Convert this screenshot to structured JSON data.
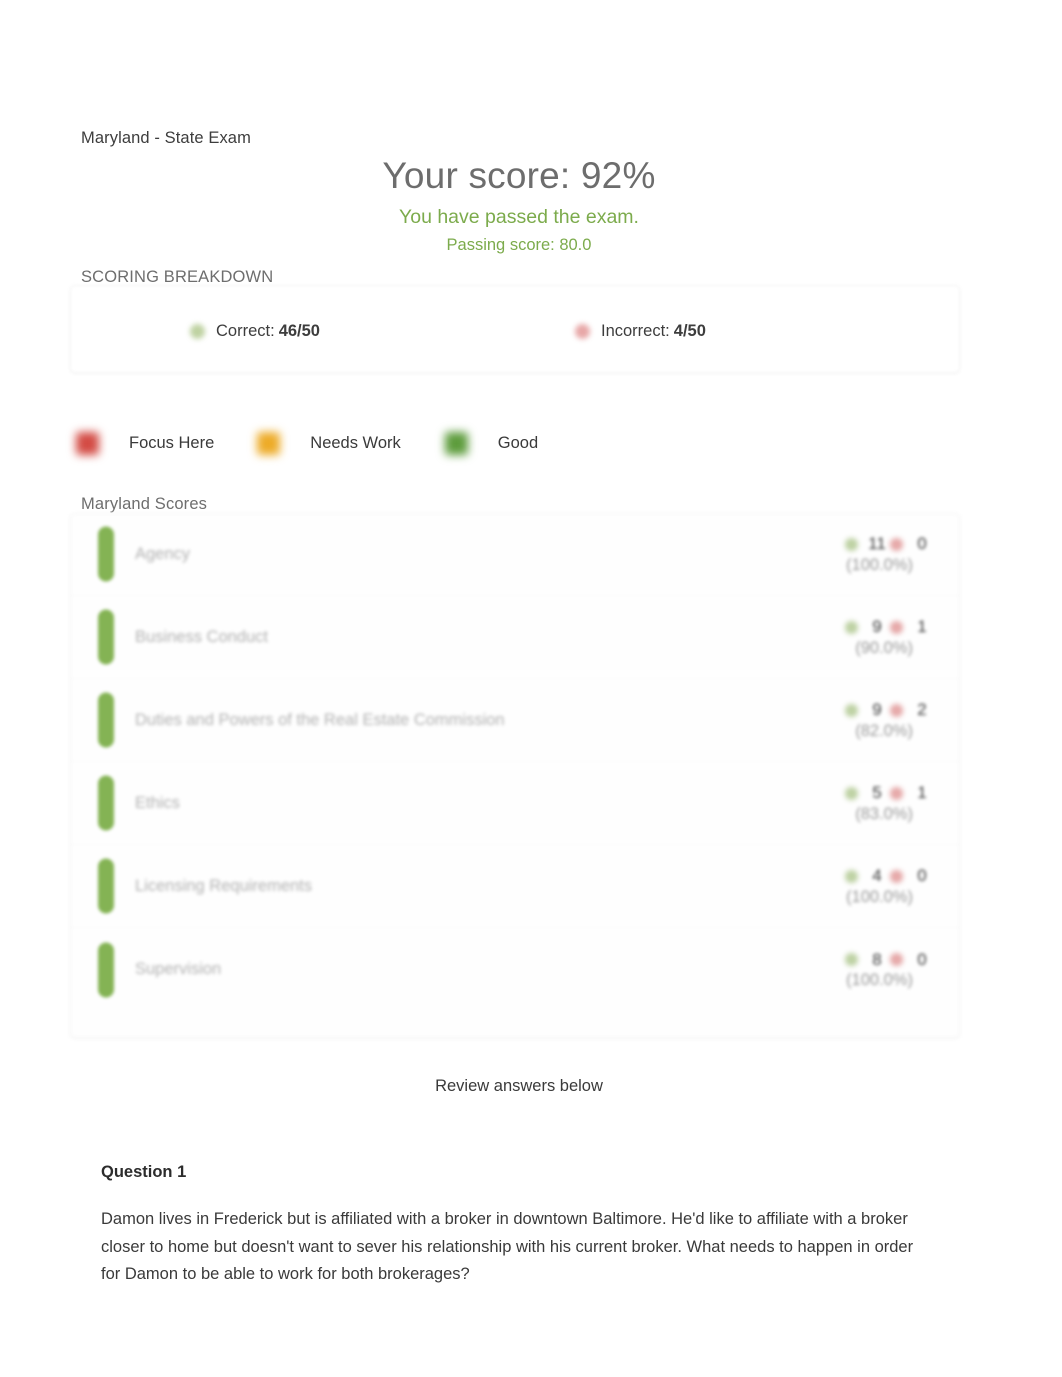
{
  "exam": {
    "title": "Maryland - State Exam"
  },
  "result": {
    "score_heading": "Your score: 92%",
    "pass_message": "You have passed the exam.",
    "passing_score_line": "Passing score: 80.0"
  },
  "breakdown": {
    "section_label": "SCORING BREAKDOWN",
    "correct_label": "Correct:",
    "correct_value": "46/50",
    "incorrect_label": "Incorrect:",
    "incorrect_value": "4/50"
  },
  "legend": {
    "items": [
      {
        "label": "Focus Here",
        "color": "#d34b44",
        "key": "focus"
      },
      {
        "label": "Needs Work",
        "color": "#edab27",
        "key": "needs"
      },
      {
        "label": "Good",
        "color": "#5d9c3c",
        "key": "good"
      }
    ]
  },
  "scores": {
    "section_label": "Maryland Scores",
    "rows": [
      {
        "topic": "Agency",
        "correct": "11",
        "incorrect": "0",
        "percent": "(100.0%)",
        "status": "good"
      },
      {
        "topic": "Business Conduct",
        "correct": "9",
        "incorrect": "1",
        "percent": "(90.0%)",
        "status": "good"
      },
      {
        "topic": "Duties and Powers of the Real Estate Commission",
        "correct": "9",
        "incorrect": "2",
        "percent": "(82.0%)",
        "status": "good"
      },
      {
        "topic": "Ethics",
        "correct": "5",
        "incorrect": "1",
        "percent": "(83.0%)",
        "status": "good"
      },
      {
        "topic": "Licensing Requirements",
        "correct": "4",
        "incorrect": "0",
        "percent": "(100.0%)",
        "status": "good"
      },
      {
        "topic": "Supervision",
        "correct": "8",
        "incorrect": "0",
        "percent": "(100.0%)",
        "status": "good"
      }
    ]
  },
  "review": {
    "heading": "Review answers below",
    "question_title": "Question 1",
    "question_text": "Damon lives in Frederick but is affiliated with a broker in downtown Baltimore. He'd like to affiliate with a broker closer to home but doesn't want to sever his relationship with his current broker. What needs to happen in order for Damon to be able to work for both brokerages?"
  },
  "colors": {
    "pass_green": "#7cab4c",
    "heading_gray": "#6d6d6d",
    "good": "#5d9c3c",
    "needs_work": "#edab27",
    "focus_here": "#d34b44"
  }
}
